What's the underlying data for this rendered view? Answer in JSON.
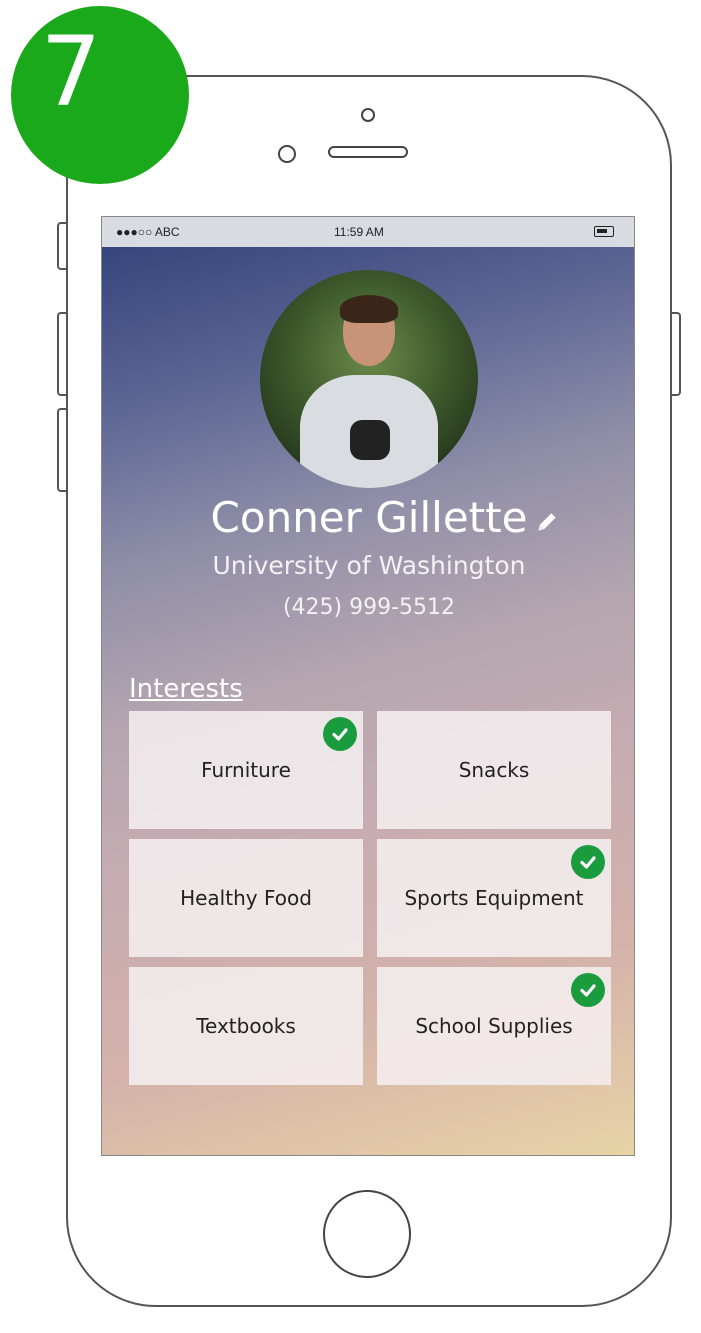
{
  "step": "7",
  "status_bar": {
    "carrier": "●●●○○ ABC",
    "time": "11:59 AM"
  },
  "profile": {
    "name": "Conner Gillette",
    "school": "University of Washington",
    "phone": "(425) 999-5512"
  },
  "interests": {
    "heading": "Interests",
    "items": [
      {
        "label": "Furniture",
        "selected": true
      },
      {
        "label": "Snacks",
        "selected": false
      },
      {
        "label": "Healthy Food",
        "selected": false
      },
      {
        "label": "Sports Equipment",
        "selected": true
      },
      {
        "label": "Textbooks",
        "selected": false
      },
      {
        "label": "School Supplies",
        "selected": true
      }
    ]
  },
  "colors": {
    "badge": "#1aa91a",
    "check": "#1a9b3d"
  }
}
